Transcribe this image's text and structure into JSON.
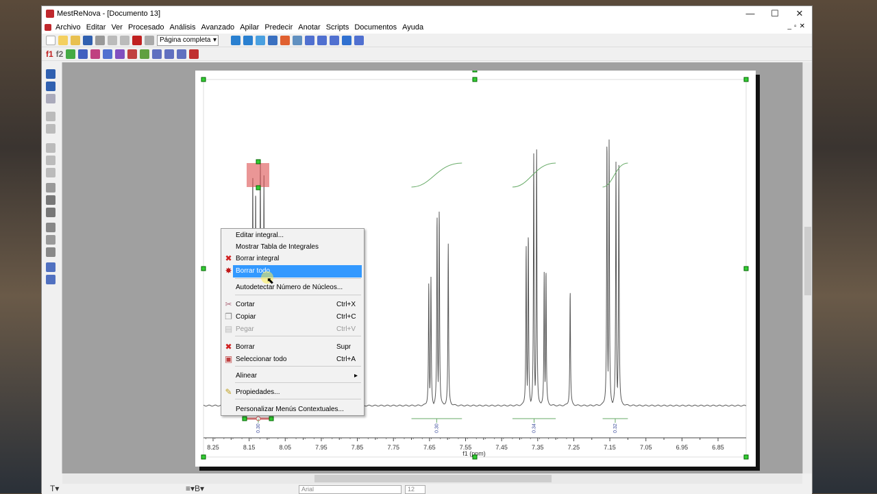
{
  "window": {
    "title": "MestReNova - [Documento 13]",
    "minimize": "—",
    "maximize": "☐",
    "close": "✕"
  },
  "menubar": [
    "Archivo",
    "Editar",
    "Ver",
    "Procesado",
    "Análisis",
    "Avanzado",
    "Apilar",
    "Predecir",
    "Anotar",
    "Scripts",
    "Documentos",
    "Ayuda"
  ],
  "toolbar": {
    "zoom_select": "Página completa",
    "f1": "f1",
    "f2": "f2"
  },
  "bottom_toolbar": {
    "font": "Arial",
    "size": "12"
  },
  "context_menu": {
    "items": [
      {
        "label": "Editar integral...",
        "shortcut": "",
        "icon": ""
      },
      {
        "label": "Mostrar Tabla de Integrales",
        "shortcut": "",
        "icon": ""
      },
      {
        "label": "Borrar integral",
        "shortcut": "",
        "icon": "red-x-icon"
      },
      {
        "label": "Borrar todo",
        "shortcut": "",
        "icon": "red-burst-icon",
        "highlighted": true
      },
      {
        "label": "Autodetectar Número de Núcleos...",
        "shortcut": "",
        "icon": ""
      },
      {
        "label": "Cortar",
        "shortcut": "Ctrl+X",
        "icon": "scissors-icon"
      },
      {
        "label": "Copiar",
        "shortcut": "Ctrl+C",
        "icon": "copy-icon"
      },
      {
        "label": "Pegar",
        "shortcut": "Ctrl+V",
        "icon": "paste-icon",
        "disabled": true
      },
      {
        "label": "Borrar",
        "shortcut": "Supr",
        "icon": "red-x-icon"
      },
      {
        "label": "Seleccionar todo",
        "shortcut": "Ctrl+A",
        "icon": "select-all-icon"
      },
      {
        "label": "Alinear",
        "shortcut": "▸",
        "icon": ""
      },
      {
        "label": "Propiedades...",
        "shortcut": "",
        "icon": "properties-icon"
      },
      {
        "label": "Personalizar Menús Contextuales...",
        "shortcut": "",
        "icon": ""
      }
    ]
  },
  "chart_data": {
    "type": "line",
    "xlabel": "f1 (ppm)",
    "xlim": [
      8.25,
      6.85
    ],
    "xticks": [
      "8.25",
      "8.15",
      "8.05",
      "7.95",
      "7.85",
      "7.75",
      "7.65",
      "7.55",
      "7.45",
      "7.35",
      "7.25",
      "7.15",
      "7.05",
      "6.95",
      "6.85"
    ],
    "peaks": [
      {
        "ppm": 8.14,
        "intensity": 0.85
      },
      {
        "ppm": 8.132,
        "intensity": 0.8
      },
      {
        "ppm": 8.119,
        "intensity": 0.89
      },
      {
        "ppm": 8.109,
        "intensity": 0.84
      },
      {
        "ppm": 7.652,
        "intensity": 0.45
      },
      {
        "ppm": 7.646,
        "intensity": 0.47
      },
      {
        "ppm": 7.629,
        "intensity": 0.7
      },
      {
        "ppm": 7.623,
        "intensity": 0.72
      },
      {
        "ppm": 7.598,
        "intensity": 0.59
      },
      {
        "ppm": 7.382,
        "intensity": 0.59
      },
      {
        "ppm": 7.376,
        "intensity": 0.63
      },
      {
        "ppm": 7.361,
        "intensity": 0.92
      },
      {
        "ppm": 7.353,
        "intensity": 0.94
      },
      {
        "ppm": 7.332,
        "intensity": 0.49
      },
      {
        "ppm": 7.327,
        "intensity": 0.5
      },
      {
        "ppm": 7.26,
        "intensity": 0.42
      },
      {
        "ppm": 7.158,
        "intensity": 0.98
      },
      {
        "ppm": 7.152,
        "intensity": 0.97
      },
      {
        "ppm": 7.133,
        "intensity": 0.89
      },
      {
        "ppm": 7.125,
        "intensity": 0.88
      }
    ],
    "integrals": [
      {
        "from": 8.14,
        "to": 8.07,
        "value": "0.30",
        "selected": true
      },
      {
        "from": 7.7,
        "to": 7.56,
        "value": "0.30"
      },
      {
        "from": 7.42,
        "to": 7.3,
        "value": "0.34"
      },
      {
        "from": 7.17,
        "to": 7.1,
        "value": "0.32"
      }
    ]
  }
}
